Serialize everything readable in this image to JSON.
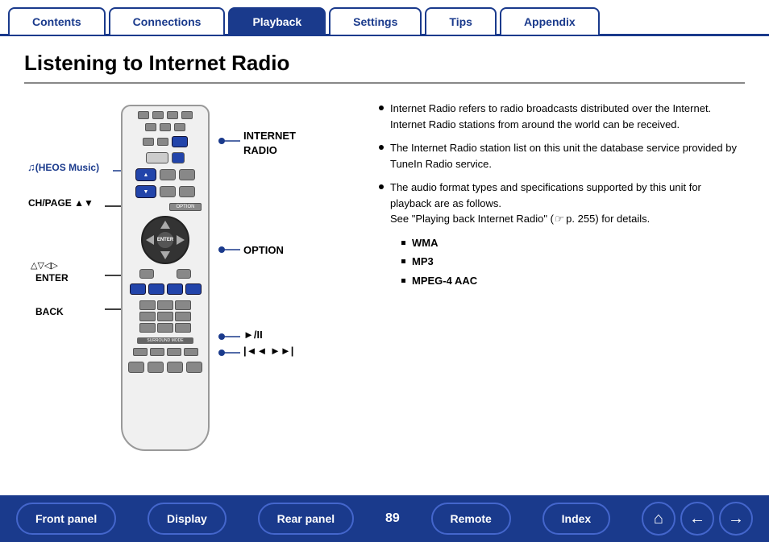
{
  "tabs": [
    {
      "label": "Contents",
      "active": false
    },
    {
      "label": "Connections",
      "active": false
    },
    {
      "label": "Playback",
      "active": true
    },
    {
      "label": "Settings",
      "active": false
    },
    {
      "label": "Tips",
      "active": false
    },
    {
      "label": "Appendix",
      "active": false
    }
  ],
  "page": {
    "title": "Listening to Internet Radio"
  },
  "callouts": {
    "internet_radio": "INTERNET\nRADIO",
    "heos_music": "(HEOS Music)",
    "ch_page": "CH/PAGE ▲▼",
    "option": "OPTION",
    "enter_arrows": "△▽◁▷",
    "enter": "ENTER",
    "back": "BACK",
    "play": "►/II",
    "transport": "|◄◄  ►►|"
  },
  "bullets": [
    {
      "text": "Internet Radio refers to radio broadcasts distributed over the Internet. Internet Radio stations from around the world can be received."
    },
    {
      "text": "The Internet Radio station list on this unit the database service provided by TuneIn Radio service."
    },
    {
      "text": "The audio format types and specifications supported by this unit for playback are as follows.\nSee \"Playing back Internet Radio\" (  p. 255) for details."
    }
  ],
  "formats": [
    "WMA",
    "MP3",
    "MPEG-4 AAC"
  ],
  "page_number": "89",
  "bottom_nav": {
    "front_panel": "Front panel",
    "display": "Display",
    "rear_panel": "Rear panel",
    "remote": "Remote",
    "index": "Index"
  }
}
